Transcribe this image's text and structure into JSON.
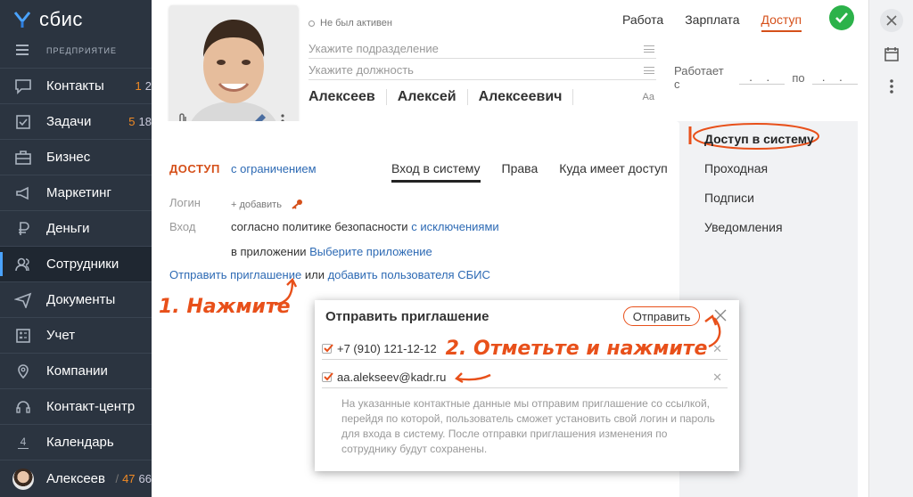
{
  "sidebar": {
    "brand": "сбис",
    "org": "ПРЕДПРИЯТИЕ",
    "items": [
      {
        "label": "Контакты",
        "count_hot": "1",
        "count": "2"
      },
      {
        "label": "Задачи",
        "count_hot": "5",
        "count": "18"
      },
      {
        "label": "Бизнес"
      },
      {
        "label": "Маркетинг"
      },
      {
        "label": "Деньги"
      },
      {
        "label": "Сотрудники"
      },
      {
        "label": "Документы"
      },
      {
        "label": "Учет"
      },
      {
        "label": "Компании"
      },
      {
        "label": "Контакт-центр"
      },
      {
        "label": "Календарь",
        "badge": "4"
      }
    ],
    "user": {
      "name": "Алексеев",
      "count_hot": "47",
      "count": "66"
    }
  },
  "header": {
    "status": "Не был активен",
    "department_placeholder": "Укажите подразделение",
    "position_placeholder": "Укажите должность",
    "last_name": "Алексеев",
    "first_name": "Алексей",
    "middle_name": "Алексеевич",
    "font_toggle": "Aa",
    "tabs": [
      "Работа",
      "Зарплата",
      "Доступ"
    ],
    "works_from": "Работает с",
    "works_to": "по",
    "date_placeholder": ". ."
  },
  "card": {
    "access_title": "ДОСТУП",
    "access_mode": "с ограничением",
    "tabs": [
      "Вход в систему",
      "Права",
      "Куда имеет доступ"
    ],
    "login_label": "Логин",
    "login_add": "+ добавить",
    "entry_label": "Вход",
    "entry_policy": "согласно политике безопасности",
    "entry_exceptions": "с исключениями",
    "app_prefix": "в приложении",
    "app_link": "Выберите приложение",
    "invite_link": "Отправить приглашение",
    "or": "или",
    "add_user_link": "добавить пользователя СБИС",
    "hint1": "1. Нажмите"
  },
  "rightnav": {
    "items": [
      "Доступ в систему",
      "Проходная",
      "Подписи",
      "Уведомления"
    ]
  },
  "popup": {
    "title": "Отправить приглашение",
    "send": "Отправить",
    "phone": "+7 (910) 121-12-12",
    "email": "aa.alekseev@kadr.ru",
    "hint2": "2. Отметьте и нажмите",
    "note": "На указанные контактные данные мы отправим приглашение со ссылкой, перейдя по которой, пользователь сможет установить свой логин и пароль для входа в систему. После отправки приглашения изменения по сотруднику будут сохранены."
  },
  "colors": {
    "accent": "#d5501a",
    "link": "#2d6ab4",
    "sidebar": "#2b3440",
    "ok": "#2cb24a"
  }
}
